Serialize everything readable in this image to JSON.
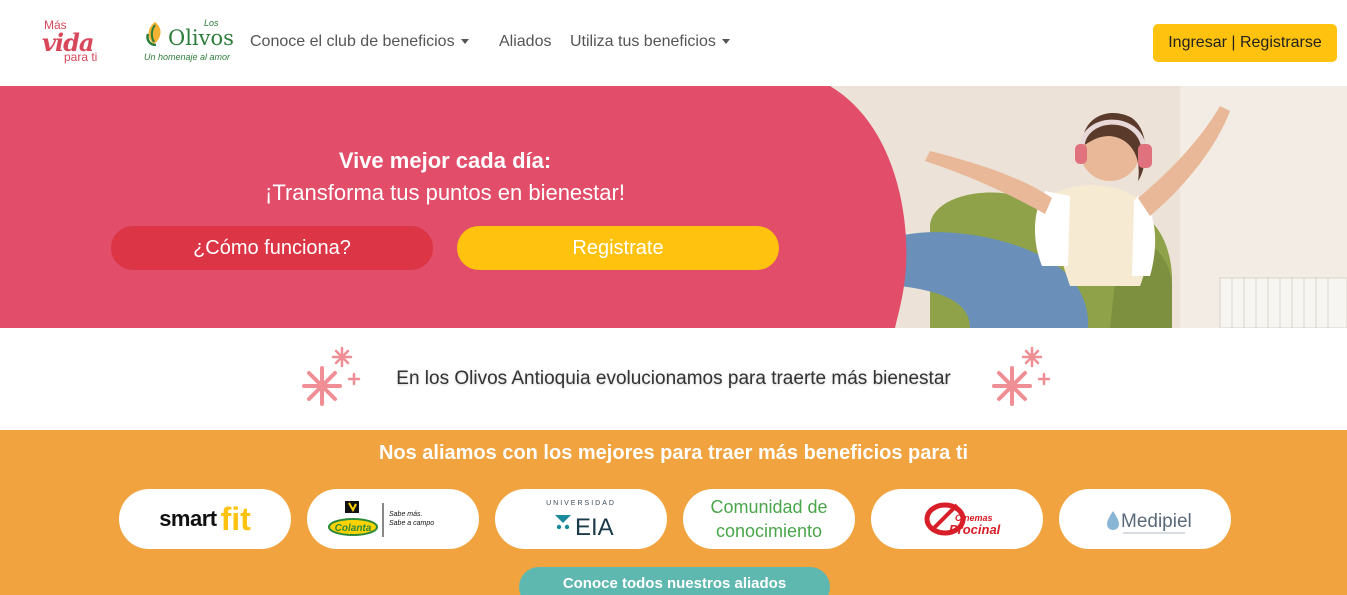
{
  "nav": {
    "logo_mvp": {
      "line1": "Más",
      "line2": "vida",
      "line3": "para ti"
    },
    "logo_olivos": {
      "los": "Los",
      "name": "Olivos",
      "tagline": "Un homenaje al amor"
    },
    "links": [
      {
        "label": "Conoce el club de beneficios",
        "dropdown": true
      },
      {
        "label": "Aliados",
        "dropdown": false
      },
      {
        "label": "Utiliza tus beneficios",
        "dropdown": true
      }
    ],
    "login_label": "Ingresar | Registrarse"
  },
  "hero": {
    "title": "Vive mejor cada día:",
    "subtitle": "¡Transforma tus puntos en bienestar!",
    "btn_how": "¿Cómo funciona?",
    "btn_register": "Registrate"
  },
  "evolution": {
    "text": "En los Olivos Antioquia evolucionamos para traerte más bienestar"
  },
  "allies": {
    "title": "Nos aliamos con los mejores para traer más beneficios para ti",
    "logos": {
      "smartfit": {
        "a": "smart",
        "b": "fit"
      },
      "colanta": {
        "name": "Colanta",
        "slogan1": "Sabe más.",
        "slogan2": "Sabe a campo"
      },
      "eia": {
        "top": "UNIVERSIDAD",
        "name": "EIA"
      },
      "comunidad": {
        "line1": "Comunidad de",
        "line2": "conocimiento"
      },
      "procinal": {
        "a": "Cinemas",
        "b": "Procinal"
      },
      "medipiel": {
        "name": "Medipiel"
      }
    },
    "all_label": "Conoce todos nuestros aliados"
  },
  "colors": {
    "brand_pink": "#e24d69",
    "accent_yellow": "#ffc20e",
    "btn_red": "#dc3545",
    "allies_orange": "#f0a33e",
    "teal": "#5fb8b0"
  }
}
